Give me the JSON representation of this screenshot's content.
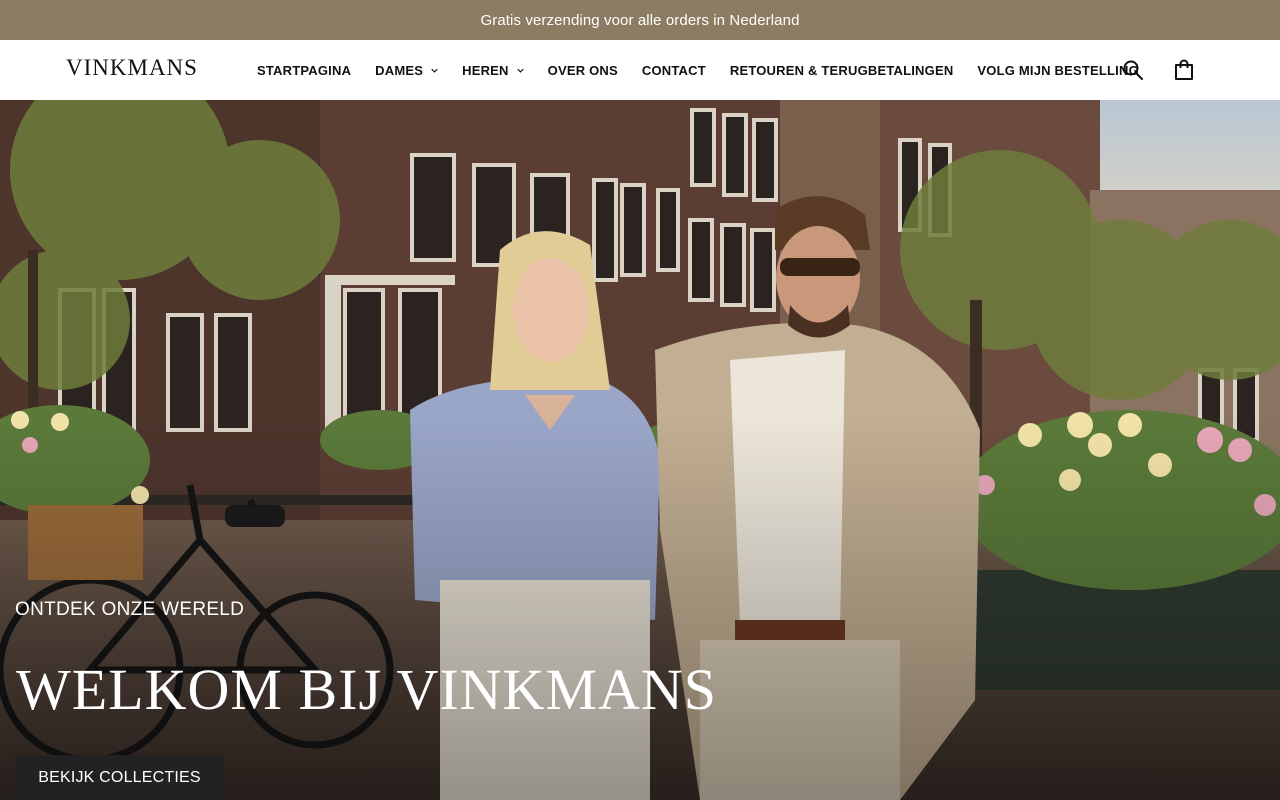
{
  "announcement": {
    "text": "Gratis verzending voor alle orders in Nederland"
  },
  "header": {
    "logo": "VINKMANS",
    "nav": [
      {
        "label": "STARTPAGINA",
        "has_dropdown": false
      },
      {
        "label": "DAMES",
        "has_dropdown": true
      },
      {
        "label": "HEREN",
        "has_dropdown": true
      },
      {
        "label": "OVER ONS",
        "has_dropdown": false
      },
      {
        "label": "CONTACT",
        "has_dropdown": false
      },
      {
        "label": "RETOUREN & TERUGBETALINGEN",
        "has_dropdown": false
      },
      {
        "label": "VOLG MIJN BESTELLING",
        "has_dropdown": false
      }
    ],
    "icons": [
      "search-icon",
      "shopping-bag-icon"
    ]
  },
  "hero": {
    "eyebrow": "ONTDEK ONZE WERELD",
    "title": "WELKOM BIJ VINKMANS",
    "cta_label": "BEKIJK COLLECTIES"
  },
  "colors": {
    "announcement_bg": "#8c7c63",
    "header_bg": "#ffffff",
    "cta_bg": "#222222",
    "text_light": "#ffffff"
  }
}
